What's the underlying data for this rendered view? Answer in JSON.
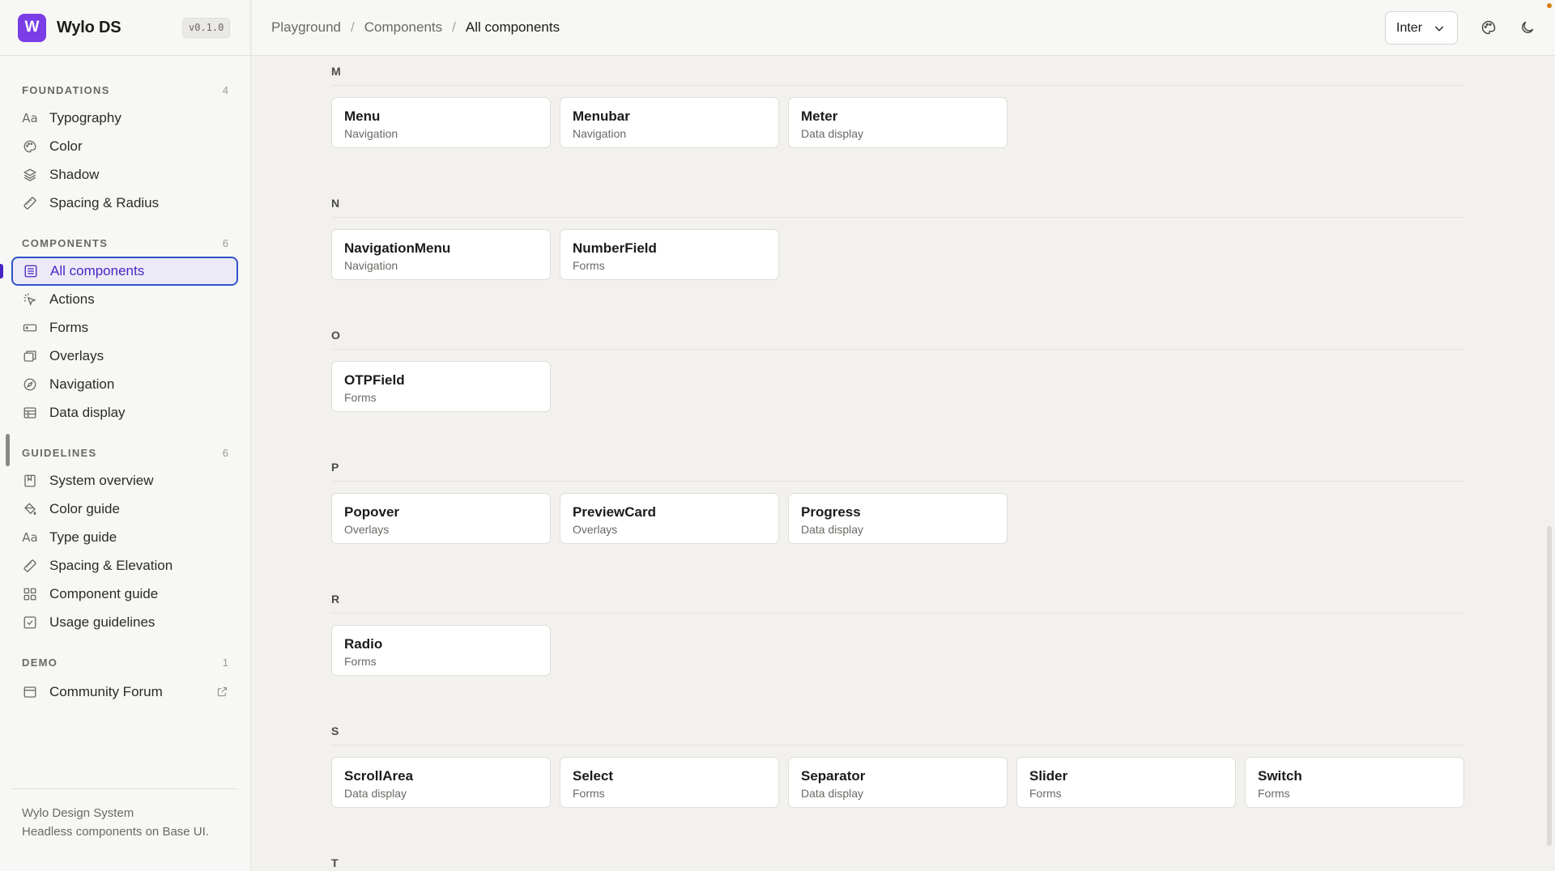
{
  "app": {
    "logo_letter": "W",
    "name": "Wylo DS",
    "version": "v0.1.0"
  },
  "sidebar": {
    "sections": [
      {
        "title": "FOUNDATIONS",
        "count": "4",
        "items": [
          {
            "label": "Typography",
            "icon": "typography-icon"
          },
          {
            "label": "Color",
            "icon": "palette-icon"
          },
          {
            "label": "Shadow",
            "icon": "layers-icon"
          },
          {
            "label": "Spacing & Radius",
            "icon": "ruler-icon"
          }
        ]
      },
      {
        "title": "COMPONENTS",
        "count": "6",
        "items": [
          {
            "label": "All components",
            "icon": "list-icon",
            "active": true
          },
          {
            "label": "Actions",
            "icon": "pointer-click-icon"
          },
          {
            "label": "Forms",
            "icon": "form-input-icon"
          },
          {
            "label": "Overlays",
            "icon": "window-stack-icon"
          },
          {
            "label": "Navigation",
            "icon": "compass-icon"
          },
          {
            "label": "Data display",
            "icon": "table-icon"
          }
        ]
      },
      {
        "title": "GUIDELINES",
        "count": "6",
        "items": [
          {
            "label": "System overview",
            "icon": "book-icon"
          },
          {
            "label": "Color guide",
            "icon": "paint-bucket-icon"
          },
          {
            "label": "Type guide",
            "icon": "typography-icon"
          },
          {
            "label": "Spacing & Elevation",
            "icon": "ruler-icon"
          },
          {
            "label": "Component guide",
            "icon": "grid-icon"
          },
          {
            "label": "Usage guidelines",
            "icon": "checkbox-icon"
          }
        ]
      },
      {
        "title": "DEMO",
        "count": "1",
        "items": [
          {
            "label": "Community Forum",
            "icon": "browser-icon",
            "external": true
          }
        ]
      }
    ],
    "footer": {
      "line1": "Wylo Design System",
      "line2": "Headless components on Base UI."
    }
  },
  "header": {
    "breadcrumbs": [
      "Playground",
      "Components",
      "All components"
    ],
    "font_select": "Inter"
  },
  "groups": [
    {
      "letter": "M",
      "cards": [
        {
          "name": "Menu",
          "category": "Navigation"
        },
        {
          "name": "Menubar",
          "category": "Navigation"
        },
        {
          "name": "Meter",
          "category": "Data display"
        }
      ]
    },
    {
      "letter": "N",
      "cards": [
        {
          "name": "NavigationMenu",
          "category": "Navigation"
        },
        {
          "name": "NumberField",
          "category": "Forms"
        }
      ]
    },
    {
      "letter": "O",
      "cards": [
        {
          "name": "OTPField",
          "category": "Forms"
        }
      ]
    },
    {
      "letter": "P",
      "cards": [
        {
          "name": "Popover",
          "category": "Overlays"
        },
        {
          "name": "PreviewCard",
          "category": "Overlays"
        },
        {
          "name": "Progress",
          "category": "Data display"
        }
      ]
    },
    {
      "letter": "R",
      "cards": [
        {
          "name": "Radio",
          "category": "Forms"
        }
      ]
    },
    {
      "letter": "S",
      "cards": [
        {
          "name": "ScrollArea",
          "category": "Data display"
        },
        {
          "name": "Select",
          "category": "Forms"
        },
        {
          "name": "Separator",
          "category": "Data display"
        },
        {
          "name": "Slider",
          "category": "Forms"
        },
        {
          "name": "Switch",
          "category": "Forms"
        }
      ]
    },
    {
      "letter": "T",
      "cards": []
    }
  ],
  "colors": {
    "brand": "#7a3de6",
    "active_text": "#4a25c4",
    "focus_ring": "#2f53c9"
  }
}
